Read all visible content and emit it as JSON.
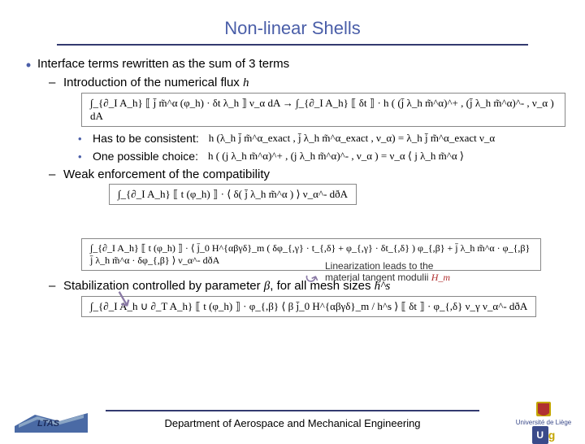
{
  "title": "Non-linear Shells",
  "bullet1": "Interface terms rewritten as the sum of 3 terms",
  "sub1": {
    "intro": "Introduction of the numerical flux ",
    "introVar": "h",
    "eq1": "∫_{∂_I A_h} ⟦ j̄ m̃^α (φ_h) · δt λ_h ⟧ ν_α dA  →  ∫_{∂_I A_h} ⟦ δt ⟧ · h ( (j̄ λ_h m̃^α)^+ , (j̄ λ_h m̃^α)^- , ν_α ) dA",
    "consistent": "Has to be consistent:",
    "eq2": "h (λ_h j̄ m̃^α_exact , j̄ λ_h m̃^α_exact , ν_α) = λ_h j̄ m̃^α_exact ν_α",
    "choice": "One possible choice:",
    "eq3": "h ( (j λ_h m̃^α)^+ , (j λ_h m̃^α)^- , ν_α ) = ν_α ⟨ j λ_h m̃^α ⟩"
  },
  "sub2": {
    "text": "Weak enforcement of the compatibility",
    "eq4": "∫_{∂_I A_h} ⟦ t (φ_h) ⟧ · ⟨ δ( j̄ λ_h m̃^α ) ⟩ ν_α^- dðA",
    "note": "Linearization leads to the material tangent modulii ",
    "noteVar": "H_m",
    "eq5": "∫_{∂_I A_h} ⟦ t (φ_h) ⟧ · ⟨ j̄_0 H^{αβγδ}_m ( δφ_{,γ} · t_{,δ} + φ_{,γ} · δt_{,δ} ) φ_{,β} + j̄ λ_h m̃^α · φ_{,β}  j̄ λ_h m̃^α · δφ_{,β} ⟩ ν_α^- dðA"
  },
  "sub3": {
    "text1": "Stabilization controlled by parameter ",
    "beta": "β",
    "text2": ", for all mesh sizes ",
    "hs": "h^s",
    "eq6": "∫_{∂_I A_h ∪ ∂_T A_h} ⟦ t (φ_h) ⟧ · φ_{,β} ⟨ β j̄_0 H^{αβγδ}_m / h^s ⟩ ⟦ δt ⟧ · φ_{,δ} ν_γ ν_α^- dðA"
  },
  "footer": "Department of Aerospace and Mechanical Engineering",
  "logos": {
    "left": "LTAS",
    "right_uni": "Université de Liège",
    "right_badge": "U",
    "right_g": "g"
  }
}
